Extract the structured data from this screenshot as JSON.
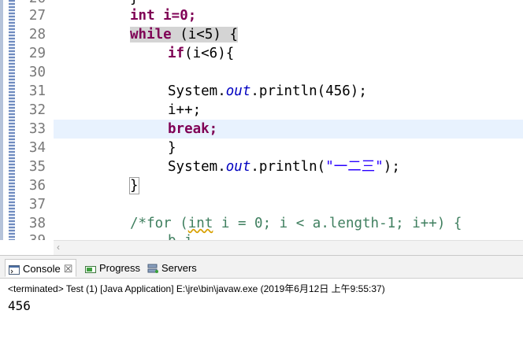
{
  "editor": {
    "partial_top_line_number": "26",
    "partial_top_line_code": "}",
    "lines": [
      {
        "n": "27",
        "code": "int i=0;"
      },
      {
        "n": "28",
        "code": "while (i<5) {"
      },
      {
        "n": "29",
        "code": "if(i<6){"
      },
      {
        "n": "30",
        "code": ""
      },
      {
        "n": "31",
        "code": "System.out.println(456);"
      },
      {
        "n": "32",
        "code": "i++;"
      },
      {
        "n": "33",
        "code": "break;"
      },
      {
        "n": "34",
        "code": "}"
      },
      {
        "n": "35",
        "code": "System.out.println(\"一二三\");"
      },
      {
        "n": "36",
        "code": "}"
      },
      {
        "n": "37",
        "code": ""
      },
      {
        "n": "38",
        "code": "/*for (int i = 0; i < a.length-1; i++) {"
      }
    ],
    "partial_bottom_line_number": "39",
    "partial_bottom_line_code": "b i"
  },
  "colors": {
    "keyword": "#7f0055",
    "field": "#0000c0",
    "string": "#2a00ff",
    "comment": "#3f7f5f",
    "current_line": "#e8f2fe"
  },
  "views": {
    "tabs": [
      {
        "label": "Console",
        "icon": "console-icon",
        "active": true
      },
      {
        "label": "Progress",
        "icon": "progress-icon",
        "active": false
      },
      {
        "label": "Servers",
        "icon": "servers-icon",
        "active": false
      }
    ],
    "console": {
      "status": "<terminated> Test (1) [Java Application] E:\\jre\\bin\\javaw.exe (2019年6月12日 上午9:55:37)",
      "output": "456"
    }
  }
}
